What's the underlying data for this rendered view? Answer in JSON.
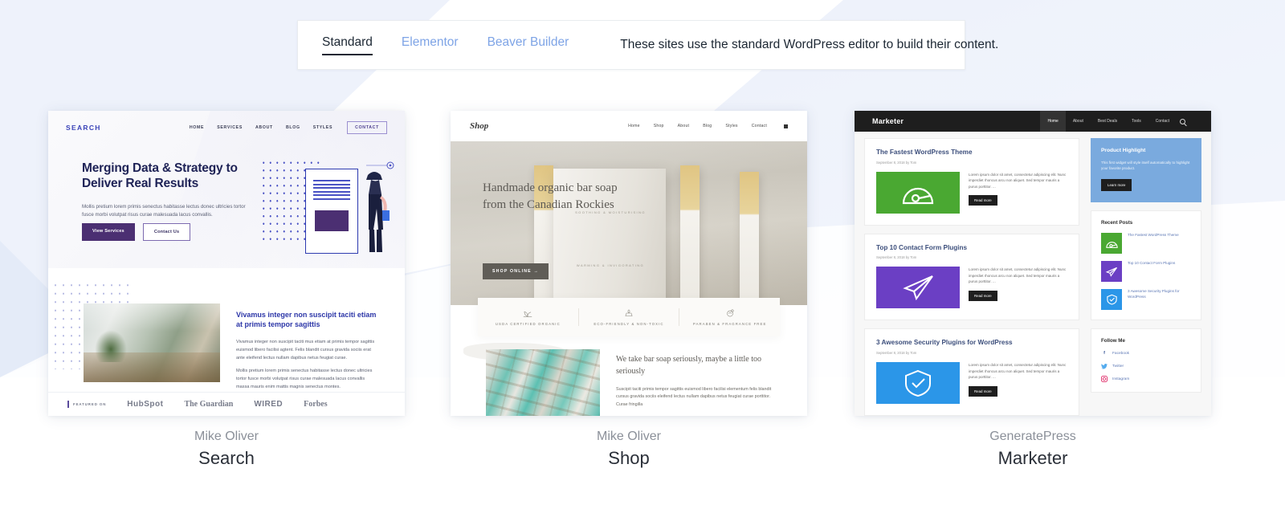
{
  "tabbar": {
    "tabs": [
      {
        "label": "Standard",
        "active": true
      },
      {
        "label": "Elementor",
        "active": false
      },
      {
        "label": "Beaver Builder",
        "active": false
      }
    ],
    "description": "These sites use the standard WordPress editor to build their content."
  },
  "cards": [
    {
      "author": "Mike Oliver",
      "title": "Search",
      "site": {
        "logo": "SEARCH",
        "nav": [
          "HOME",
          "SERVICES",
          "ABOUT",
          "BLOG",
          "STYLES"
        ],
        "nav_button": "CONTACT",
        "headline": "Merging Data & Strategy to Deliver Real Results",
        "paragraph": "Mollis pretium lorem primis senectus habitasse lectus donec ultricies tortor fusce morbi volutpat risus curae malesuada lacus convallis.",
        "buttons": [
          "View Services",
          "Contact Us"
        ],
        "section_heading": "Vivamus integer non suscipit taciti etiam at primis tempor sagittis",
        "section_body_1": "Vivamus integer non suscipit taciti mus etiam at primis tempor sagittis euismod libero facilisi agtent. Felis blandit cursus gravida sociis erat ante eleifend lectus nullam dapibus netus feugiat curae.",
        "section_body_2": "Mollis pretium lorem primis senectus habitasse lectus donec ultricies tortor fusce morbi volutpat risus curae malesuada lacus convallis massa mauris enim mattis magnis senectus montes.",
        "featured_label": "FEATURED ON",
        "featured_brands": [
          "HubSpot",
          "The Guardian",
          "WIRED",
          "Forbes"
        ]
      }
    },
    {
      "author": "Mike Oliver",
      "title": "Shop",
      "site": {
        "logo": "Shop",
        "nav": [
          "Home",
          "Shop",
          "About",
          "Blog",
          "Styles",
          "Contact"
        ],
        "headline": "Handmade organic bar soap from the Canadian Rockies",
        "cta": "SHOP ONLINE →",
        "product_text_1": "SOOTHING & MOISTURISING",
        "product_text_2": "WARMING & INVIGORATING",
        "features": [
          {
            "label": "USDA CERTIFIED ORGANIC",
            "icon": "plant-icon"
          },
          {
            "label": "ECO-FRIENDLY & NON-TOXIC",
            "icon": "leaf-box-icon"
          },
          {
            "label": "PARABEN & FRAGRANCE FREE",
            "icon": "bottle-icon"
          }
        ],
        "section_heading": "We take bar soap seriously, maybe a little too seriously",
        "section_body": "Suscipit taciti primis tempor sagittis euismod libero facilisi elementum felis blandit cursus gravida sociis eleifend lectus nullam dapibus netus feugiat curae porttitor. Curae fringilla"
      }
    },
    {
      "author": "GeneratePress",
      "title": "Marketer",
      "site": {
        "logo": "Marketer",
        "nav": [
          "Home",
          "About",
          "Best Deals",
          "Tools",
          "Contact"
        ],
        "search_icon": "search-icon",
        "posts": [
          {
            "title": "The Fastest WordPress Theme",
            "meta": "September 8, 2018 by Tom",
            "excerpt": "Lorem ipsum dolor sit amet, consectetur adipiscing elit. Nunc imperdiet rhoncus arcu non aliquet. Sed tempor mauris a purus porttitor. ...",
            "read_more": "Read more",
            "thumb_color": "#4aa832",
            "thumb_icon": "speedometer-icon"
          },
          {
            "title": "Top 10 Contact Form Plugins",
            "meta": "September 8, 2018 by Tom",
            "excerpt": "Lorem ipsum dolor sit amet, consectetur adipiscing elit. Nunc imperdiet rhoncus arcu non aliquet. Sed tempor mauris a purus porttitor. ...",
            "read_more": "Read more",
            "thumb_color": "#6b3fc4",
            "thumb_icon": "paper-plane-icon"
          },
          {
            "title": "3 Awesome Security Plugins for WordPress",
            "meta": "September 8, 2018 by Tom",
            "excerpt": "Lorem ipsum dolor sit amet, consectetur adipiscing elit. Nunc imperdiet rhoncus arcu non aliquet. Sed tempor mauris a purus porttitor. ...",
            "read_more": "Read more",
            "thumb_color": "#2b96e8",
            "thumb_icon": "shield-check-icon"
          }
        ],
        "widget_highlight": {
          "title": "Product Highlight",
          "text": "This first widget will style itself automatically to highlight your favorite product.",
          "button": "Learn more",
          "color": "#7aaade"
        },
        "widget_recent": {
          "title": "Recent Posts",
          "items": [
            {
              "text": "The Fastest WordPress Theme",
              "color": "#4aa832",
              "icon": "speedometer-icon"
            },
            {
              "text": "Top 10 Contact Form Plugins",
              "color": "#6b3fc4",
              "icon": "paper-plane-icon"
            },
            {
              "text": "3 Awesome Security Plugins for WordPress",
              "color": "#2b96e8",
              "icon": "shield-check-icon"
            }
          ]
        },
        "widget_follow": {
          "title": "Follow Me",
          "items": [
            {
              "text": "Facebook",
              "icon": "facebook-icon",
              "color": "#3b5998"
            },
            {
              "text": "Twitter",
              "icon": "twitter-icon",
              "color": "#55acee"
            },
            {
              "text": "Instagram",
              "icon": "instagram-icon",
              "color": "#e1306c"
            }
          ]
        }
      }
    }
  ]
}
